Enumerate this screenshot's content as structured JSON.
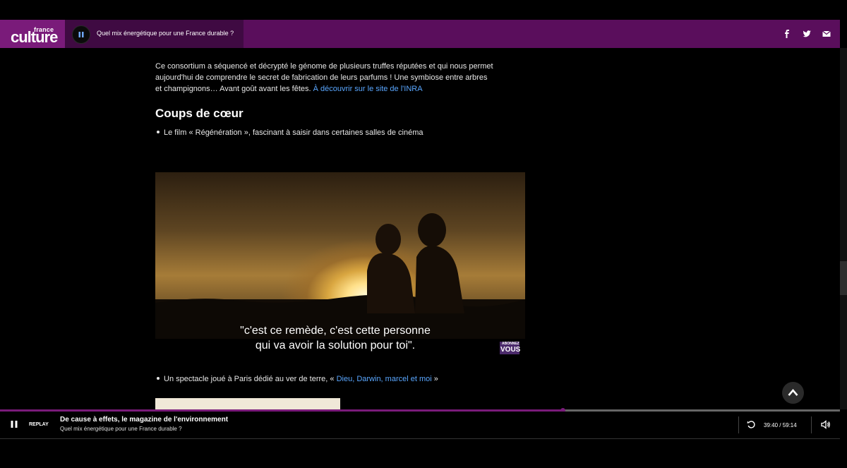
{
  "header": {
    "logo_small": "france",
    "logo_big": "culture",
    "now_playing_title": "Quel mix énergétique pour une France durable ?",
    "social_icons": [
      "facebook-icon",
      "twitter-icon",
      "email-icon"
    ]
  },
  "article": {
    "paragraph_text": "Ce consortium a séquencé et décrypté le génome de plusieurs truffes réputées et qui nous permet aujourd'hui de comprendre le secret de fabrication de leurs parfums ! Une symbiose entre arbres et champignons… Avant goût avant les fêtes. ",
    "paragraph_link": "À découvrir sur le site de l'INRA",
    "heading": "Coups de cœur",
    "item1": "Le film « Régénération », fascinant à saisir dans certaines salles de cinéma",
    "item2_prefix": "Un spectacle joué à Paris dédié au ver de terre, « ",
    "item2_link": "Dieu, Darwin, marcel et moi",
    "item2_suffix": " »"
  },
  "video": {
    "subtitle_line1": "\"c'est ce remède, c'est cette personne",
    "subtitle_line2": "qui va avoir la solution pour toi\".",
    "badge_small": "ABONNEZ",
    "badge_big": "VOUS"
  },
  "player": {
    "replay_label": "REPLAY",
    "show_title": "De cause à effets, le magazine de l'environnement",
    "episode_title": "Quel mix énergétique pour une France durable ?",
    "time": "39:40 / 59:14",
    "progress": 0.67
  },
  "colors": {
    "brand": "#5a0e5c",
    "link": "#5aa7ff"
  }
}
